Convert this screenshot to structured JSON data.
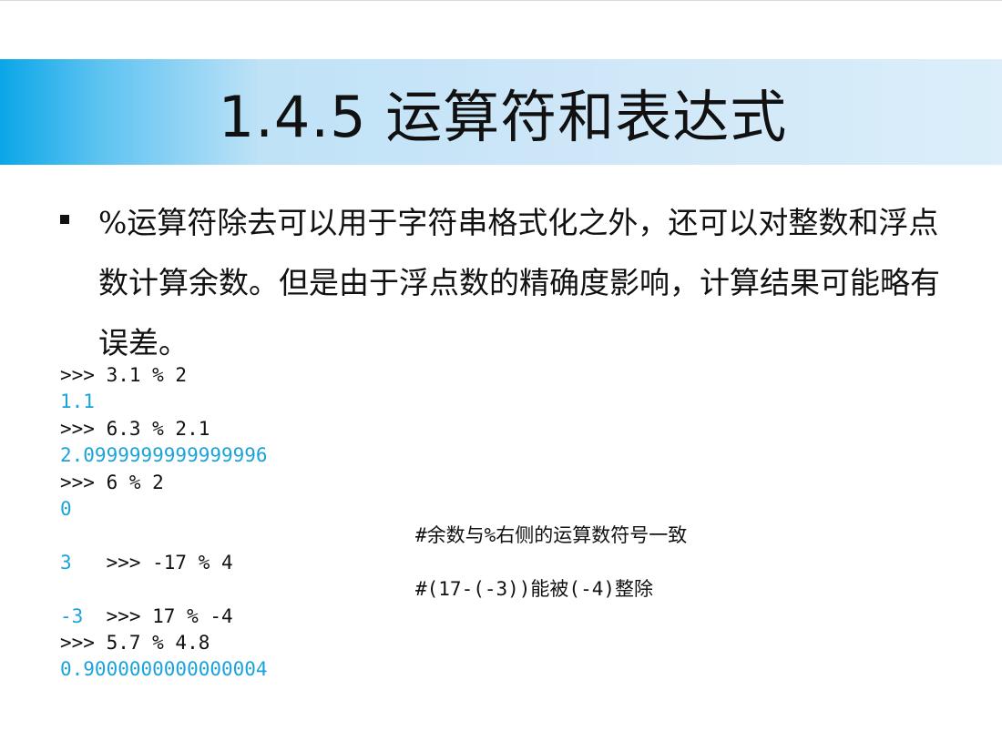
{
  "slide": {
    "title": "1.4.5  运算符和表达式",
    "bullet_text": "%运算符除去可以用于字符串格式化之外，还可以对整数和浮点数计算余数。但是由于浮点数的精确度影响，计算结果可能略有误差。"
  },
  "colors": {
    "title_band_left": "#0aa6e8",
    "title_band_right": "#dbeefa",
    "output_text": "#1aa3db",
    "prompt_text": "#111111"
  },
  "code": {
    "line0": ">>> 3.1 % 2",
    "line1": "1.1",
    "line2": ">>> 6.3 % 2.1",
    "line3": "2.0999999999999996",
    "line4": ">>> 6 % 2",
    "line5": "0",
    "line6": ">>> -17 % 4",
    "line6_comment": "#余数与%右侧的运算数符号一致",
    "line7": "3",
    "line8": ">>> 17 % -4",
    "line8_comment": "#(17-(-3))能被(-4)整除",
    "line9": "-3",
    "line10": ">>> 5.7 % 4.8",
    "line11": "0.9000000000000004"
  }
}
